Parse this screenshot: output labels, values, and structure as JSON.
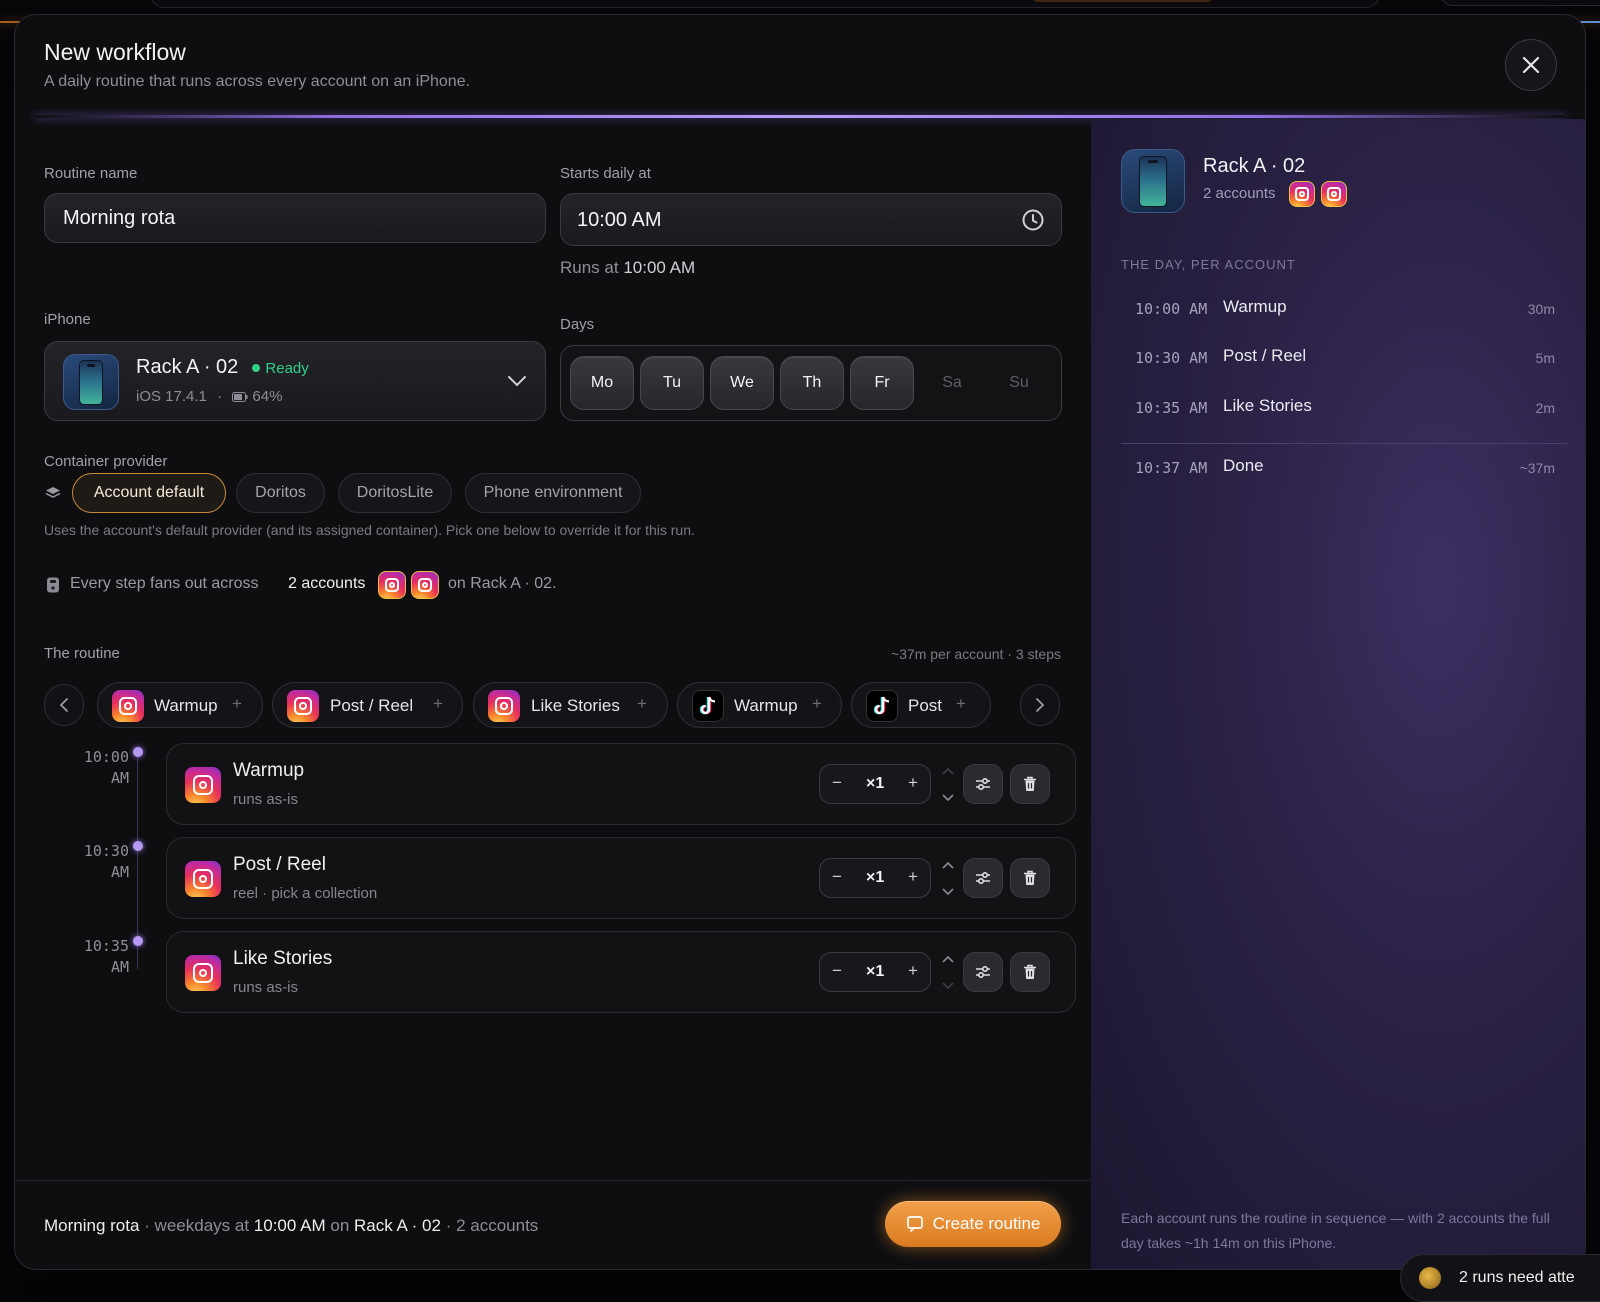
{
  "modal": {
    "title": "New workflow",
    "subtitle": "A daily routine that runs across every account on an iPhone."
  },
  "form": {
    "routine_name_label": "Routine name",
    "routine_name_value": "Morning rota",
    "starts_label": "Starts daily at",
    "starts_value": "10:00 AM",
    "runs_at_prefix": "Runs at",
    "runs_at_value": "10:00 AM",
    "iphone_label": "iPhone",
    "device_name": "Rack A · 02",
    "device_status": "Ready",
    "device_ios": "iOS 17.4.1",
    "device_sep": "·",
    "device_battery": "64%",
    "days_label": "Days",
    "days": [
      {
        "label": "Mo",
        "active": true
      },
      {
        "label": "Tu",
        "active": true
      },
      {
        "label": "We",
        "active": true
      },
      {
        "label": "Th",
        "active": true
      },
      {
        "label": "Fr",
        "active": true
      },
      {
        "label": "Sa",
        "active": false
      },
      {
        "label": "Su",
        "active": false
      }
    ],
    "provider_label": "Container provider",
    "providers": [
      "Account default",
      "Doritos",
      "DoritosLite",
      "Phone environment"
    ],
    "provider_selected": "Account default",
    "provider_hint": "Uses the account's default provider (and its assigned container). Pick one below to override it for this run.",
    "fanout_prefix": "Every step fans out across",
    "fanout_accounts": "2 accounts",
    "fanout_suffix": "on Rack A · 02."
  },
  "routine": {
    "label": "The routine",
    "meta": "~37m per account · 3 steps",
    "palette": [
      {
        "platform": "instagram",
        "label": "Warmup",
        "plus": "+"
      },
      {
        "platform": "instagram",
        "label": "Post / Reel",
        "plus": "+"
      },
      {
        "platform": "instagram",
        "label": "Like Stories",
        "plus": "+"
      },
      {
        "platform": "tiktok",
        "label": "Warmup",
        "plus": "+"
      },
      {
        "platform": "tiktok",
        "label": "Post",
        "plus": "+"
      }
    ],
    "steps": [
      {
        "time1": "10:00",
        "time2": "AM",
        "name": "Warmup",
        "desc": "runs as-is",
        "minus": "−",
        "count": "×1",
        "plus": "+"
      },
      {
        "time1": "10:30",
        "time2": "AM",
        "name": "Post / Reel",
        "desc": "reel · pick a collection",
        "minus": "−",
        "count": "×1",
        "plus": "+"
      },
      {
        "time1": "10:35",
        "time2": "AM",
        "name": "Like Stories",
        "desc": "runs as-is",
        "minus": "−",
        "count": "×1",
        "plus": "+"
      }
    ]
  },
  "footer": {
    "name": "Morning rota",
    "sep1": "· weekdays at",
    "time": "10:00 AM",
    "on": "on",
    "device": "Rack A · 02",
    "accounts": "· 2 accounts",
    "create_label": "Create routine"
  },
  "preview": {
    "device_name": "Rack A · 02",
    "accounts": "2 accounts",
    "section_title": "THE DAY, PER ACCOUNT",
    "rows": [
      {
        "time": "10:00 AM",
        "name": "Warmup",
        "dur": "30m"
      },
      {
        "time": "10:30 AM",
        "name": "Post / Reel",
        "dur": "5m"
      },
      {
        "time": "10:35 AM",
        "name": "Like Stories",
        "dur": "2m"
      }
    ],
    "done": {
      "time": "10:37 AM",
      "name": "Done",
      "dur": "~37m"
    },
    "note": "Each account runs the routine in sequence — with 2 accounts the full day takes ~1h 14m on this iPhone."
  },
  "toast": {
    "text": "2 runs need atte"
  },
  "colors": {
    "accent": "#e58a2e",
    "ready": "#2fd08a",
    "timeline": "#b69af2",
    "panel": "#2a2144"
  }
}
